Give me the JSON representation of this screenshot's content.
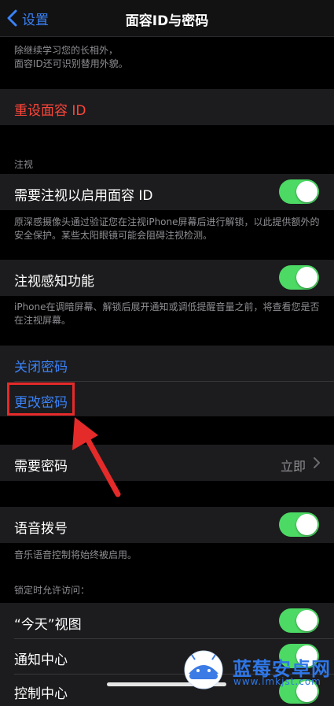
{
  "nav": {
    "back_label": "设置",
    "title": "面容ID与密码"
  },
  "faceid": {
    "footer": "除继续学习您的长相外，\n面容ID还可识别替用外貌。",
    "reset_label": "重设面容 ID"
  },
  "attention": {
    "header": "注视",
    "require_label": "需要注视以启用面容 ID",
    "require_on": true,
    "require_footer": "原深感摄像头通过验证您在注视iPhone屏幕后进行解锁，以此提供额外的安全保护。某些太阳眼镜可能会阻碍注视检测。",
    "aware_label": "注视感知功能",
    "aware_on": true,
    "aware_footer": "iPhone在调暗屏幕、解锁后展开通知或调低提醒音量之前，将查看您是否在注视屏幕。"
  },
  "passcode": {
    "turn_off_label": "关闭密码",
    "change_label": "更改密码",
    "require_label": "需要密码",
    "require_value": "立即"
  },
  "voice": {
    "label": "语音拨号",
    "on": true,
    "footer": "音乐语音控制将始终被启用。"
  },
  "locked": {
    "header": "锁定时允许访问：",
    "items": [
      {
        "label": "“今天”视图",
        "on": true
      },
      {
        "label": "通知中心",
        "on": true
      },
      {
        "label": "控制中心",
        "on": true
      }
    ]
  },
  "watermark": {
    "name": "蓝莓安卓网",
    "url": "www.lmkjst.com"
  },
  "colors": {
    "accent": "#3a82f7",
    "destructive": "#ff453a",
    "toggle_on": "#4cd964",
    "annotation": "#e52a2a"
  }
}
